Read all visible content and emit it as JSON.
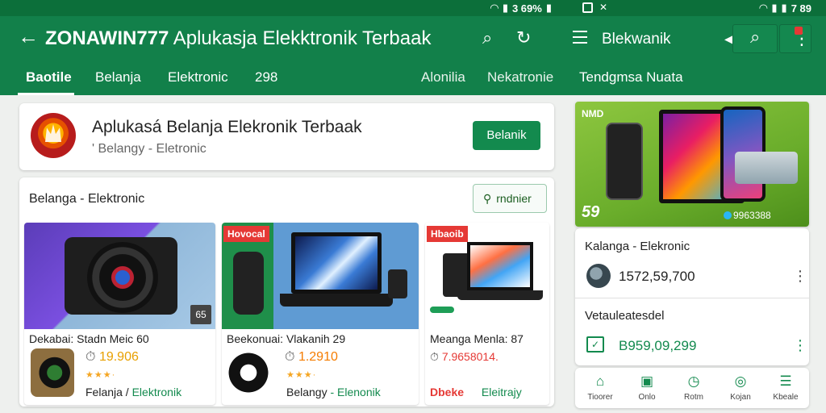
{
  "status_bar": {
    "left_status": "3 69%",
    "right_status": "7 89"
  },
  "app_bar": {
    "title_bold": "ZONAWIN777",
    "title_rest": " Aplukasja Elekktronik Terbaak",
    "secondary_title": "Blekwanik"
  },
  "tabs": [
    {
      "label": "Baotile",
      "active": true
    },
    {
      "label": "Belanja",
      "active": false
    },
    {
      "label": "Elektronic",
      "active": false
    },
    {
      "label": "298",
      "active": false
    },
    {
      "label": "Alonilia",
      "active": false
    },
    {
      "label": "Nekatronie",
      "active": false
    },
    {
      "label": "Tendgmsa Nuata",
      "active": false
    }
  ],
  "app_card": {
    "title": "Aplukasá Belanja Elekronik Terbaak",
    "subtitle": "' Belangy - Eletronic",
    "install_label": "Belanik"
  },
  "section": {
    "title": "Belanga - Elektronic",
    "button_label": "rndnier"
  },
  "products": [
    {
      "name": "Dekabai: Stadn Meic 60",
      "price": "19.906",
      "stars": "★★★·",
      "category_black": "Felanja /",
      "category_green": "Elektronik",
      "badge": "65"
    },
    {
      "tag": "Hovocal",
      "name": "Beekonuai: Vlakanih 29",
      "price": "1.2910",
      "stars": "★★★·",
      "category_black": "Belangy",
      "category_green": "- Elenonik"
    },
    {
      "tag": "Hbaoib",
      "name": "Meanga Menla: 87",
      "price": "7.9658014.",
      "category_black": "Dbeke",
      "category_green": "Eleitrajy"
    }
  ],
  "promo": {
    "label": "NMD",
    "price": "59",
    "counter": "9963388"
  },
  "side_list": [
    {
      "title": "Kalanga - Elekronic",
      "value": "1572,59,700"
    },
    {
      "title": "Vetauleatesdel",
      "value": "B959,09,299"
    }
  ],
  "bottom_nav": [
    {
      "label": "Tioorer",
      "icon": "home-icon"
    },
    {
      "label": "Onlo",
      "icon": "chart-icon"
    },
    {
      "label": "Rotm",
      "icon": "clock-icon"
    },
    {
      "label": "Kojan",
      "icon": "compass-icon"
    },
    {
      "label": "Kbeale",
      "icon": "menu-icon"
    }
  ],
  "colors": {
    "primary": "#12804a",
    "status_bar": "#0c6f3a",
    "accent_price": "#e8a000",
    "tag_red": "#e53935"
  }
}
